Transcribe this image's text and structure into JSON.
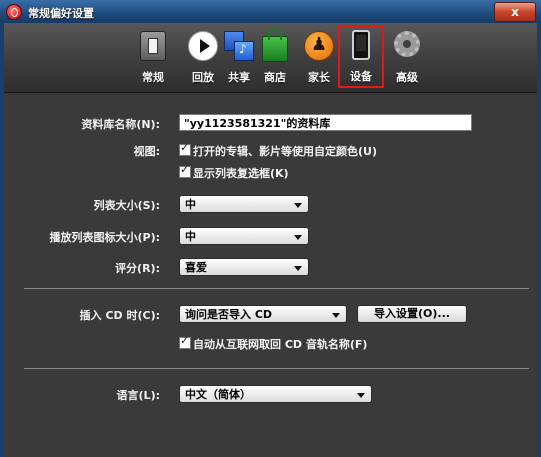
{
  "window": {
    "title": "常规偏好设置",
    "close_label": "x"
  },
  "toolbar": {
    "items": [
      {
        "label": "常规",
        "icon": "general-switch-icon",
        "selected": true
      },
      {
        "label": "回放",
        "icon": "playback-icon"
      },
      {
        "label": "共享",
        "icon": "sharing-icon"
      },
      {
        "label": "商店",
        "icon": "store-bag-icon"
      },
      {
        "label": "家长",
        "icon": "parental-icon"
      },
      {
        "label": "设备",
        "icon": "iphone-icon",
        "highlighted": true
      },
      {
        "label": "高级",
        "icon": "gear-icon"
      }
    ],
    "highlight_color": "#e01818"
  },
  "library": {
    "label": "资料库名称(N):",
    "value": "\"yy1123581321\"的资料库"
  },
  "view": {
    "label": "视图:",
    "option1": "打开的专辑、影片等使用自定颜色(U)",
    "option2": "显示列表复选框(K)"
  },
  "list_size": {
    "label": "列表大小(S):",
    "value": "中"
  },
  "playlist_icon_size": {
    "label": "播放列表图标大小(P):",
    "value": "中"
  },
  "rating": {
    "label": "评分(R):",
    "value": "喜爱"
  },
  "cd_insert": {
    "label": "插入 CD 时(C):",
    "value": "询问是否导入 CD",
    "import_button": "导入设置(O)...",
    "auto_name": "自动从互联网取回 CD 音轨名称(F)"
  },
  "language": {
    "label": "语言(L):",
    "value": "中文（简体）"
  }
}
